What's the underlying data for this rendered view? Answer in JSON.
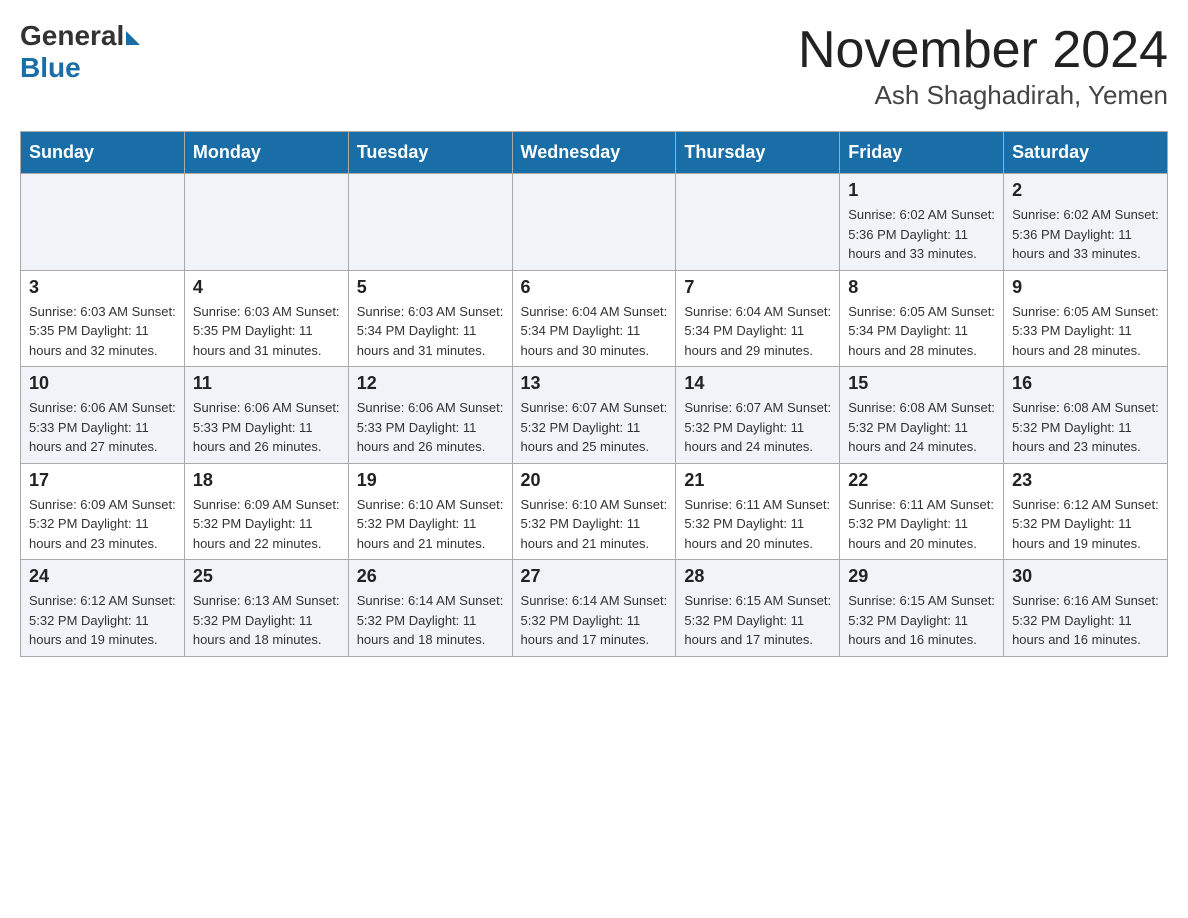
{
  "header": {
    "logo": {
      "general": "General",
      "blue": "Blue"
    },
    "month_title": "November 2024",
    "location": "Ash Shaghadirah, Yemen"
  },
  "calendar": {
    "days_of_week": [
      "Sunday",
      "Monday",
      "Tuesday",
      "Wednesday",
      "Thursday",
      "Friday",
      "Saturday"
    ],
    "weeks": [
      [
        {
          "day": "",
          "info": ""
        },
        {
          "day": "",
          "info": ""
        },
        {
          "day": "",
          "info": ""
        },
        {
          "day": "",
          "info": ""
        },
        {
          "day": "",
          "info": ""
        },
        {
          "day": "1",
          "info": "Sunrise: 6:02 AM\nSunset: 5:36 PM\nDaylight: 11 hours and 33 minutes."
        },
        {
          "day": "2",
          "info": "Sunrise: 6:02 AM\nSunset: 5:36 PM\nDaylight: 11 hours and 33 minutes."
        }
      ],
      [
        {
          "day": "3",
          "info": "Sunrise: 6:03 AM\nSunset: 5:35 PM\nDaylight: 11 hours and 32 minutes."
        },
        {
          "day": "4",
          "info": "Sunrise: 6:03 AM\nSunset: 5:35 PM\nDaylight: 11 hours and 31 minutes."
        },
        {
          "day": "5",
          "info": "Sunrise: 6:03 AM\nSunset: 5:34 PM\nDaylight: 11 hours and 31 minutes."
        },
        {
          "day": "6",
          "info": "Sunrise: 6:04 AM\nSunset: 5:34 PM\nDaylight: 11 hours and 30 minutes."
        },
        {
          "day": "7",
          "info": "Sunrise: 6:04 AM\nSunset: 5:34 PM\nDaylight: 11 hours and 29 minutes."
        },
        {
          "day": "8",
          "info": "Sunrise: 6:05 AM\nSunset: 5:34 PM\nDaylight: 11 hours and 28 minutes."
        },
        {
          "day": "9",
          "info": "Sunrise: 6:05 AM\nSunset: 5:33 PM\nDaylight: 11 hours and 28 minutes."
        }
      ],
      [
        {
          "day": "10",
          "info": "Sunrise: 6:06 AM\nSunset: 5:33 PM\nDaylight: 11 hours and 27 minutes."
        },
        {
          "day": "11",
          "info": "Sunrise: 6:06 AM\nSunset: 5:33 PM\nDaylight: 11 hours and 26 minutes."
        },
        {
          "day": "12",
          "info": "Sunrise: 6:06 AM\nSunset: 5:33 PM\nDaylight: 11 hours and 26 minutes."
        },
        {
          "day": "13",
          "info": "Sunrise: 6:07 AM\nSunset: 5:32 PM\nDaylight: 11 hours and 25 minutes."
        },
        {
          "day": "14",
          "info": "Sunrise: 6:07 AM\nSunset: 5:32 PM\nDaylight: 11 hours and 24 minutes."
        },
        {
          "day": "15",
          "info": "Sunrise: 6:08 AM\nSunset: 5:32 PM\nDaylight: 11 hours and 24 minutes."
        },
        {
          "day": "16",
          "info": "Sunrise: 6:08 AM\nSunset: 5:32 PM\nDaylight: 11 hours and 23 minutes."
        }
      ],
      [
        {
          "day": "17",
          "info": "Sunrise: 6:09 AM\nSunset: 5:32 PM\nDaylight: 11 hours and 23 minutes."
        },
        {
          "day": "18",
          "info": "Sunrise: 6:09 AM\nSunset: 5:32 PM\nDaylight: 11 hours and 22 minutes."
        },
        {
          "day": "19",
          "info": "Sunrise: 6:10 AM\nSunset: 5:32 PM\nDaylight: 11 hours and 21 minutes."
        },
        {
          "day": "20",
          "info": "Sunrise: 6:10 AM\nSunset: 5:32 PM\nDaylight: 11 hours and 21 minutes."
        },
        {
          "day": "21",
          "info": "Sunrise: 6:11 AM\nSunset: 5:32 PM\nDaylight: 11 hours and 20 minutes."
        },
        {
          "day": "22",
          "info": "Sunrise: 6:11 AM\nSunset: 5:32 PM\nDaylight: 11 hours and 20 minutes."
        },
        {
          "day": "23",
          "info": "Sunrise: 6:12 AM\nSunset: 5:32 PM\nDaylight: 11 hours and 19 minutes."
        }
      ],
      [
        {
          "day": "24",
          "info": "Sunrise: 6:12 AM\nSunset: 5:32 PM\nDaylight: 11 hours and 19 minutes."
        },
        {
          "day": "25",
          "info": "Sunrise: 6:13 AM\nSunset: 5:32 PM\nDaylight: 11 hours and 18 minutes."
        },
        {
          "day": "26",
          "info": "Sunrise: 6:14 AM\nSunset: 5:32 PM\nDaylight: 11 hours and 18 minutes."
        },
        {
          "day": "27",
          "info": "Sunrise: 6:14 AM\nSunset: 5:32 PM\nDaylight: 11 hours and 17 minutes."
        },
        {
          "day": "28",
          "info": "Sunrise: 6:15 AM\nSunset: 5:32 PM\nDaylight: 11 hours and 17 minutes."
        },
        {
          "day": "29",
          "info": "Sunrise: 6:15 AM\nSunset: 5:32 PM\nDaylight: 11 hours and 16 minutes."
        },
        {
          "day": "30",
          "info": "Sunrise: 6:16 AM\nSunset: 5:32 PM\nDaylight: 11 hours and 16 minutes."
        }
      ]
    ]
  }
}
